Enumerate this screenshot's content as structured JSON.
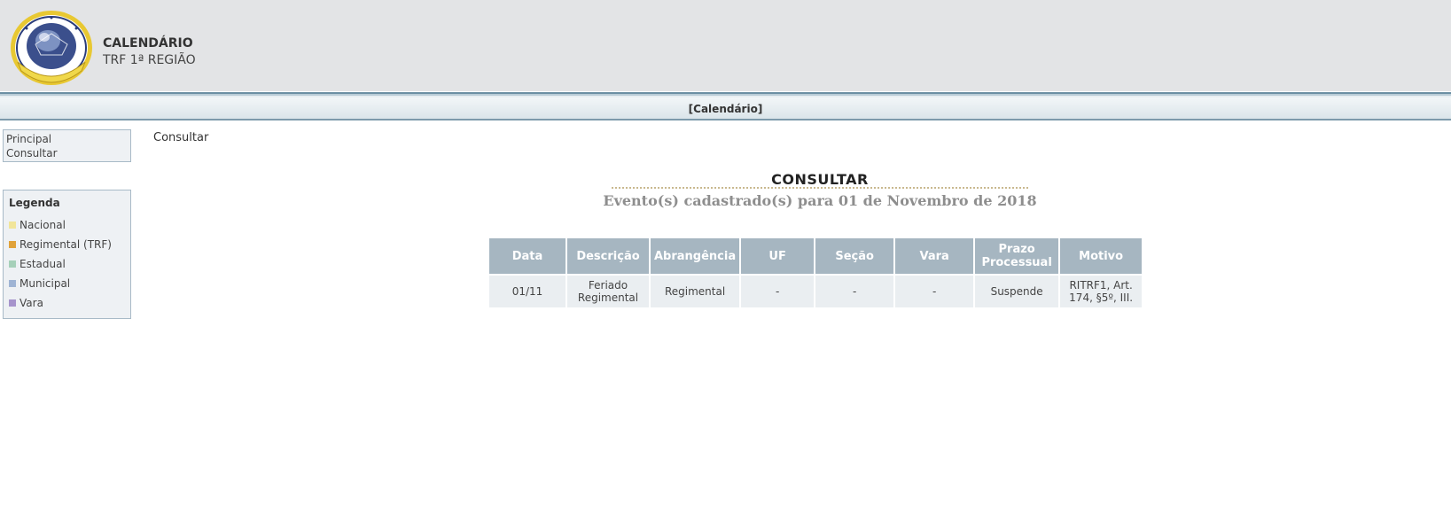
{
  "header": {
    "title": "CALENDÁRIO",
    "subtitle": "TRF 1ª REGIÃO",
    "logo_icon": "court-seal-icon",
    "colors": {
      "background": "#e3e4e6",
      "stripe": "#6b8fa3"
    }
  },
  "navbar": {
    "label": "[Calendário]"
  },
  "sidebar": {
    "menu": [
      {
        "label": "Principal"
      },
      {
        "label": "Consultar"
      }
    ],
    "legend": {
      "title": "Legenda",
      "items": [
        {
          "label": "Nacional",
          "color": "#f1e59a"
        },
        {
          "label": "Regimental (TRF)",
          "color": "#e0a23a"
        },
        {
          "label": "Estadual",
          "color": "#a6d0b9"
        },
        {
          "label": "Municipal",
          "color": "#9fb4d4"
        },
        {
          "label": "Vara",
          "color": "#a694cc"
        }
      ]
    }
  },
  "main": {
    "breadcrumb": "Consultar",
    "title": "CONSULTAR",
    "subtitle": "Evento(s) cadastrado(s) para 01 de Novembro de 2018",
    "table": {
      "headers": [
        "Data",
        "Descrição",
        "Abrangência",
        "UF",
        "Seção",
        "Vara",
        "Prazo Processual",
        "Motivo"
      ],
      "rows": [
        [
          "01/11",
          "Feriado Regimental",
          "Regimental",
          "-",
          "-",
          "-",
          "Suspende",
          "RITRF1, Art. 174, §5º, III."
        ]
      ]
    }
  }
}
